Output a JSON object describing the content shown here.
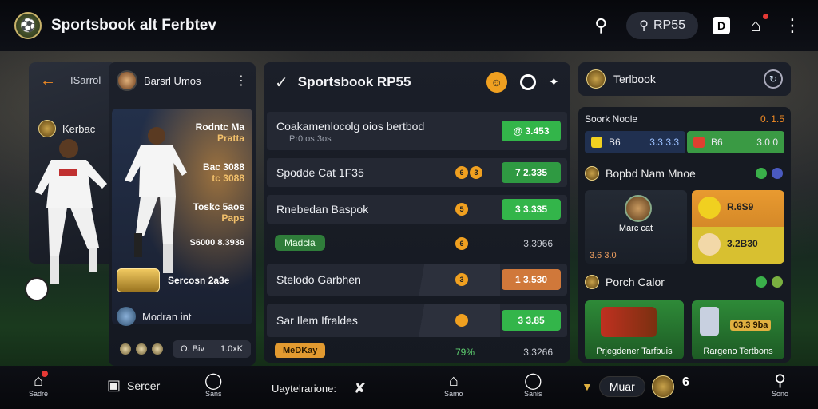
{
  "header": {
    "title": "Sportsbook alt Ferbtev",
    "search_label": "RP55",
    "badge_letter": "D",
    "icons": [
      "search-icon",
      "home-icon",
      "more-vert-icon"
    ]
  },
  "left_panel": {
    "back_title": "ISarrol",
    "team_label": "Kerbac",
    "card_title": "Barsrl Umos",
    "stats": [
      {
        "top": "Rodntc Ma",
        "sub": "Pratta"
      },
      {
        "top": "Bac 3088",
        "sub": "tc 3088"
      },
      {
        "top": "Toskc 5aos",
        "sub": "Paps"
      }
    ],
    "score_line": "S6000 8.3936",
    "gold_text": "Sercosn 2a3e",
    "moderator": "Modran int",
    "foot_left": "O. Biv",
    "foot_right": "1.0xK"
  },
  "center": {
    "title": "Sportsbook RP55",
    "rows": [
      {
        "label": "Coakamenlocolg oios bertbod",
        "sub": "Pr0tos 3os",
        "odds": "@ 3.453"
      },
      {
        "label": "Spodde Cat 1F35",
        "odds": "7 2.335"
      },
      {
        "label": "Rnebedan Baspok",
        "odds": "3 3.335"
      },
      {
        "pill": "Madcla",
        "num": "3.3966"
      },
      {
        "label": "Stelodo Garbhen",
        "odds": "1 3.530"
      },
      {
        "label": "Sar Ilem Ifraldes",
        "odds": "3 3.85"
      },
      {
        "pill": "MeDKay",
        "green": "79%",
        "num": "3.3266"
      }
    ],
    "chip_values": [
      "6",
      "3",
      "5",
      "6",
      "3"
    ]
  },
  "right_panel": {
    "head_title": "Terlbook",
    "sport_mode": "Soork Noole",
    "sport_mode_value": "0. 1.5",
    "bet_a": {
      "label": "B6",
      "value": "3.3 3.3"
    },
    "bet_b": {
      "label": "B6",
      "value": "3.0 0"
    },
    "section1": "Bopbd Nam Mnoe",
    "tile1_caption": "Marc cat",
    "tile2_top": "R.6S9",
    "tile2_bottom": "3.2B30",
    "tile1_value": "3.6 3.0",
    "section2": "Porch Calor",
    "tile3_caption": "Prjegdener Tarfbuis",
    "tile4_caption": "Rargeno Tertbons",
    "tile4_value": "03.3 9ba"
  },
  "bottom_nav": {
    "items": [
      {
        "label": "Sadre",
        "icon": "home-icon"
      },
      {
        "label": "Sercer",
        "icon": "cup-icon"
      },
      {
        "label": "Sans",
        "icon": "clock-icon"
      },
      {
        "label": "Uaytelrarione:",
        "icon": "whistle-icon"
      },
      {
        "label": "Samo",
        "icon": "stadium-icon"
      },
      {
        "label": "Sanis",
        "icon": "timer-icon"
      },
      {
        "label": "Muar",
        "icon": "crest-icon"
      },
      {
        "label": "Sono",
        "icon": "search-icon"
      }
    ],
    "count_badge": "6"
  }
}
